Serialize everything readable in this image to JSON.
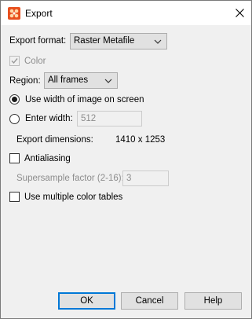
{
  "window": {
    "title": "Export"
  },
  "export_format": {
    "label": "Export format:",
    "value": "Raster Metafile"
  },
  "color": {
    "label": "Color",
    "checked": true
  },
  "region": {
    "label": "Region:",
    "value": "All frames"
  },
  "use_width": {
    "label": "Use width of image on screen",
    "selected": true
  },
  "enter_width": {
    "label": "Enter width:",
    "value": "512"
  },
  "export_dimensions": {
    "label": "Export dimensions:",
    "value": "1410 x 1253"
  },
  "antialiasing": {
    "label": "Antialiasing",
    "checked": false
  },
  "supersample": {
    "label": "Supersample factor (2-16):",
    "value": "3"
  },
  "multiple_color_tables": {
    "label": "Use multiple color tables",
    "checked": false
  },
  "buttons": {
    "ok": "OK",
    "cancel": "Cancel",
    "help": "Help"
  },
  "colors": {
    "accent": "#0078d7",
    "app_icon": "#e8501e"
  }
}
